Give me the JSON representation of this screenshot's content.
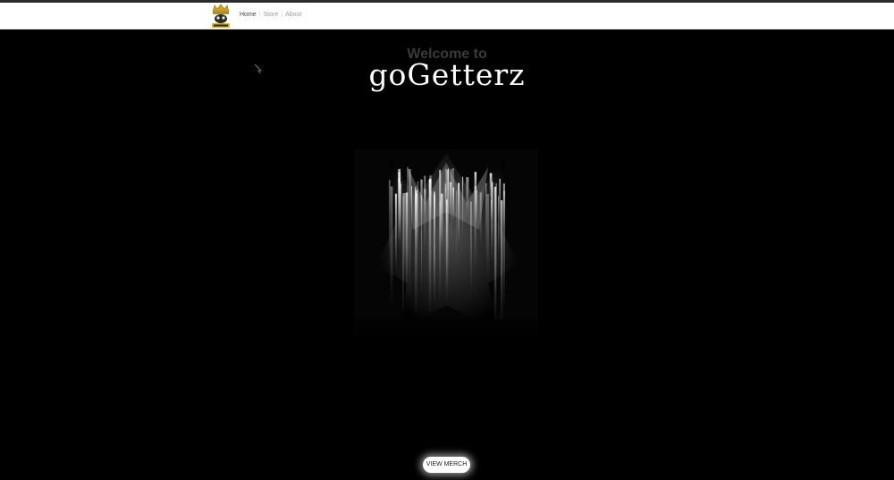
{
  "header": {
    "nav": [
      {
        "label": "Home",
        "active": true
      },
      {
        "label": "Store",
        "active": false
      },
      {
        "label": "About",
        "active": false
      }
    ],
    "separator": "|"
  },
  "hero": {
    "welcome": "Welcome to",
    "brand": "goGetterz"
  },
  "cta": {
    "label": "VIEW MERCH"
  },
  "colors": {
    "background": "#000000",
    "header_bg": "#ffffff",
    "logo_gold": "#c9a227",
    "nav_active": "#444444",
    "nav_inactive": "#9a9a9a"
  },
  "icons": {
    "logo": "crown-logo-icon",
    "cursor": "mouse-cursor-icon"
  }
}
